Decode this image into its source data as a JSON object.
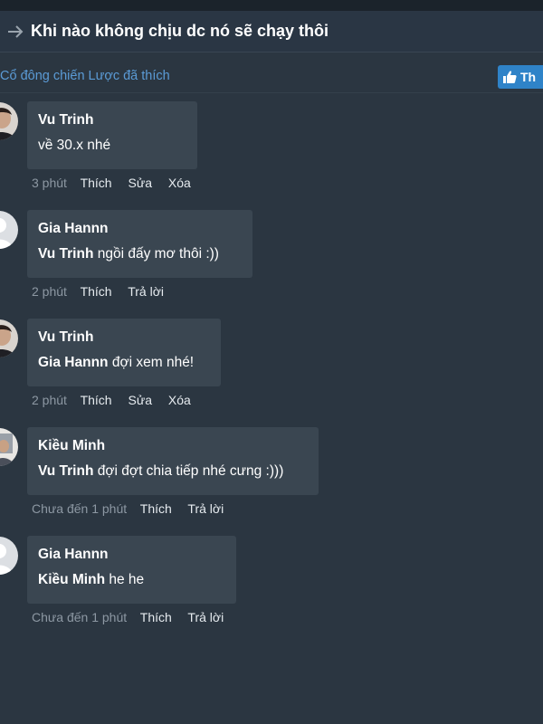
{
  "header": {
    "title": "Khi nào không chịu dc nó sẽ chạy thôi"
  },
  "likes": {
    "text": "Cổ đông chiến Lược đã thích",
    "like_button_label": "Th"
  },
  "comments": [
    {
      "author": "Vu Trinh",
      "mention": "",
      "text": "về 30.x nhé",
      "time": "3 phút",
      "actions": [
        "Thích",
        "Sửa",
        "Xóa"
      ],
      "avatar": "photo-avatar"
    },
    {
      "author": "Gia Hannn",
      "mention": "Vu Trinh",
      "text": " ngồi đấy mơ thôi :))",
      "time": "2 phút",
      "actions": [
        "Thích",
        "Trả lời"
      ],
      "avatar": "default-avatar"
    },
    {
      "author": "Vu Trinh",
      "mention": "Gia Hannn",
      "text": "đợi xem nhé!",
      "time": "2 phút",
      "actions": [
        "Thích",
        "Sửa",
        "Xóa"
      ],
      "avatar": "photo-avatar"
    },
    {
      "author": "Kiều Minh",
      "mention": "Vu Trinh",
      "text": "đợi đợt chia tiếp nhé cưng :)))",
      "time": "Chưa đến 1 phút",
      "actions": [
        "Thích",
        "Trả lời"
      ],
      "avatar": "photo-avatar-2"
    },
    {
      "author": "Gia Hannn",
      "mention": "Kiều Minh",
      "text": " he he",
      "time": "Chưa đến 1 phút",
      "actions": [
        "Thích",
        "Trả lời"
      ],
      "avatar": "default-avatar"
    }
  ],
  "colors": {
    "background": "#2b3641",
    "bubble": "#3a4651",
    "link": "#5b9bd6",
    "like_button": "#2f83c8"
  }
}
